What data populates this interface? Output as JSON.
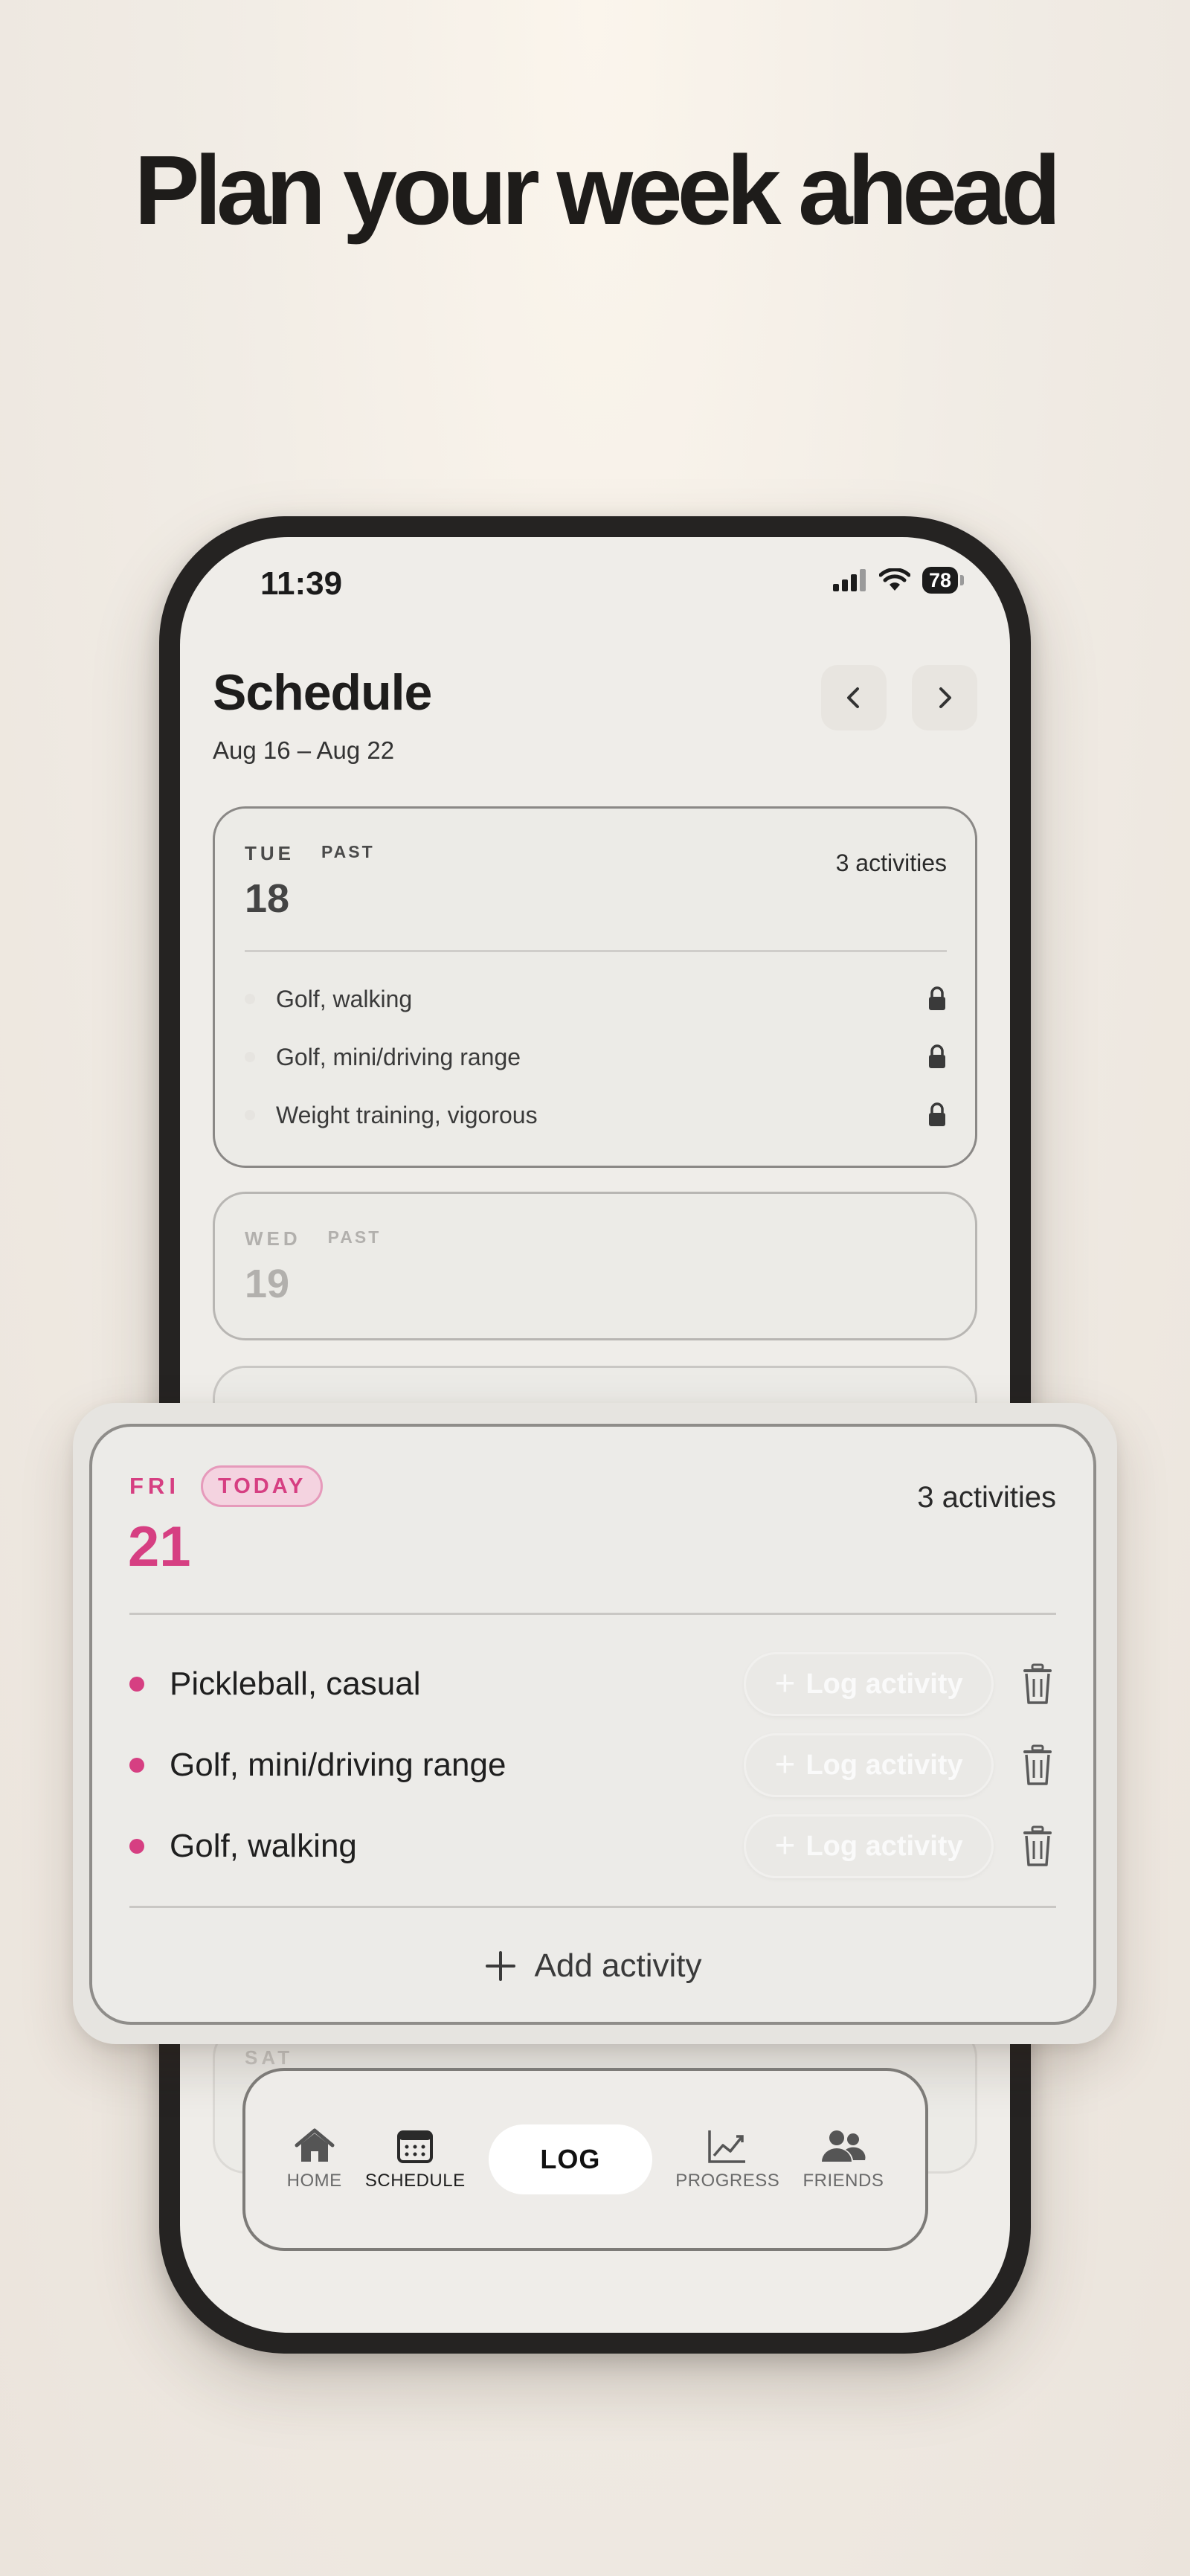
{
  "headline": "Plan your week ahead",
  "status": {
    "time": "11:39",
    "battery": "78"
  },
  "schedule": {
    "title": "Schedule",
    "range": "Aug 16 – Aug 22"
  },
  "days": [
    {
      "dow": "TUE",
      "state": "PAST",
      "num": "18",
      "count": "3 activities",
      "activities": [
        "Golf, walking",
        "Golf, mini/driving range",
        "Weight training, vigorous"
      ]
    },
    {
      "dow": "WED",
      "state": "PAST",
      "num": "19"
    },
    {
      "dow": "SAT"
    }
  ],
  "today": {
    "dow": "FRI",
    "badge": "TODAY",
    "num": "21",
    "count": "3 activities",
    "activities": [
      "Pickleball, casual",
      "Golf, mini/driving range",
      "Golf, walking"
    ],
    "log_label": "Log activity",
    "add_label": "Add activity"
  },
  "tabbar": {
    "home": "HOME",
    "schedule": "SCHEDULE",
    "log": "LOG",
    "progress": "PROGRESS",
    "friends": "FRIENDS"
  },
  "colors": {
    "accent": "#d63f82",
    "background": "#efede9"
  }
}
